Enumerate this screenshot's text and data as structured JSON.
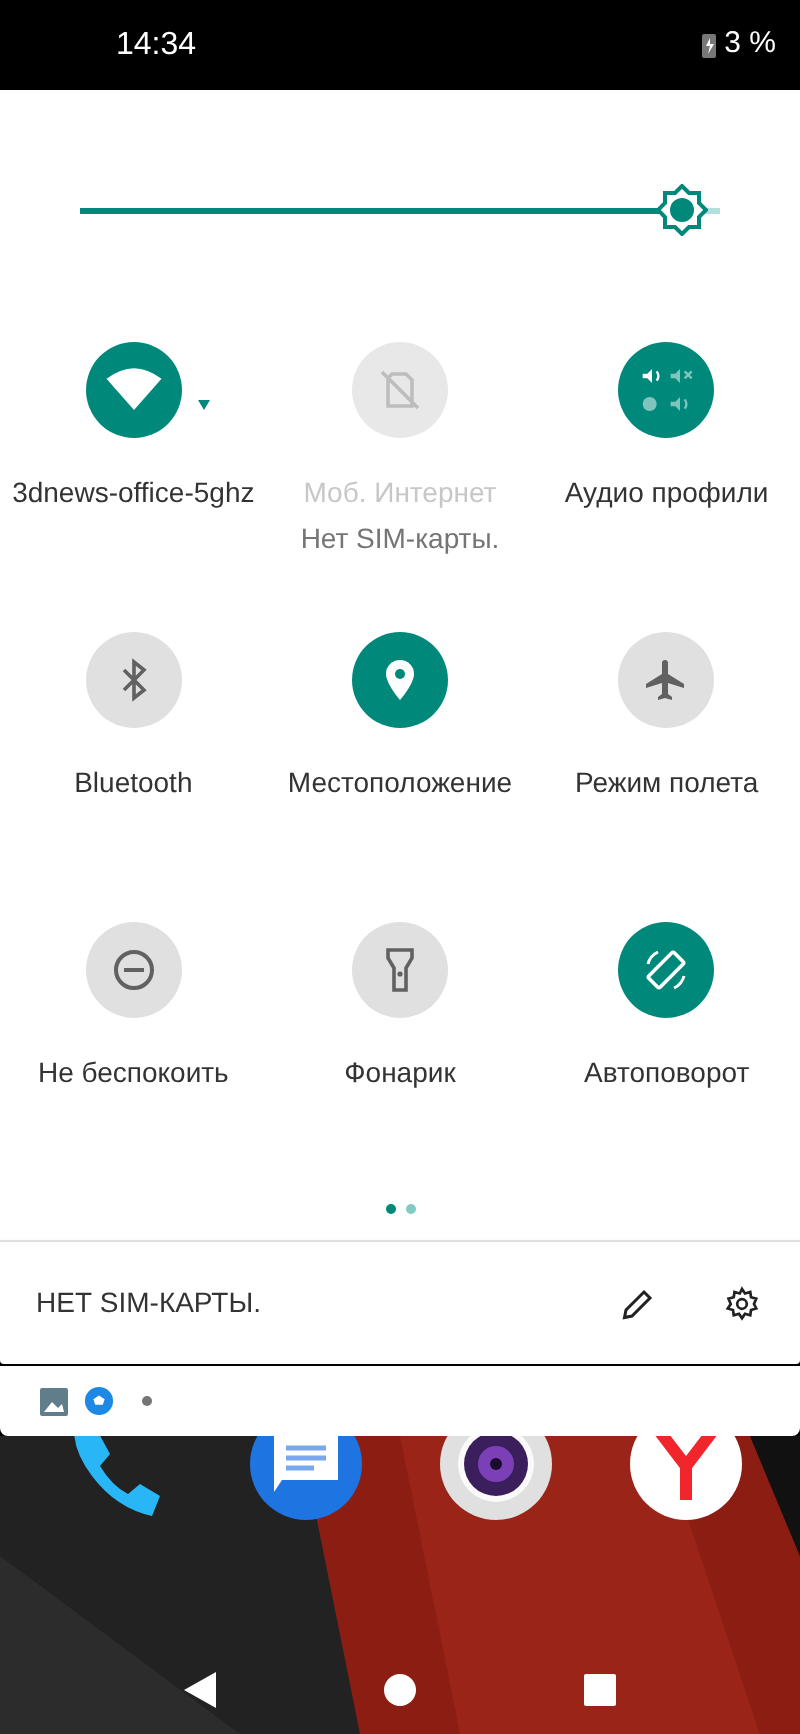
{
  "status_bar": {
    "time": "14:34",
    "battery": "3 %"
  },
  "brightness": {
    "level": 0.98
  },
  "tiles": [
    {
      "kind": "wifi",
      "label": "3dnews-office-5ghz",
      "on": true,
      "disabled": false,
      "dropdown": true
    },
    {
      "kind": "mobile-data",
      "label": "Моб. Интернет",
      "sublabel": "Нет SIM-карты.",
      "on": false,
      "disabled": true,
      "dropdown": false
    },
    {
      "kind": "audio",
      "label": "Аудио профили",
      "on": true,
      "disabled": false,
      "dropdown": false
    },
    {
      "kind": "bluetooth",
      "label": "Bluetooth",
      "on": false,
      "disabled": false,
      "dropdown": false
    },
    {
      "kind": "location",
      "label": "Местоположение",
      "on": true,
      "disabled": false,
      "dropdown": false
    },
    {
      "kind": "airplane",
      "label": "Режим полета",
      "on": false,
      "disabled": false,
      "dropdown": false
    },
    {
      "kind": "dnd",
      "label": "Не беспокоить",
      "on": false,
      "disabled": false,
      "dropdown": false
    },
    {
      "kind": "flashlight",
      "label": "Фонарик",
      "on": false,
      "disabled": false,
      "dropdown": false
    },
    {
      "kind": "rotate",
      "label": "Автоповорот",
      "on": true,
      "disabled": false,
      "dropdown": false
    }
  ],
  "pages": [
    {
      "selected": true
    },
    {
      "selected": false
    }
  ],
  "footer": {
    "carrier": "НЕТ SIM-КАРТЫ."
  }
}
